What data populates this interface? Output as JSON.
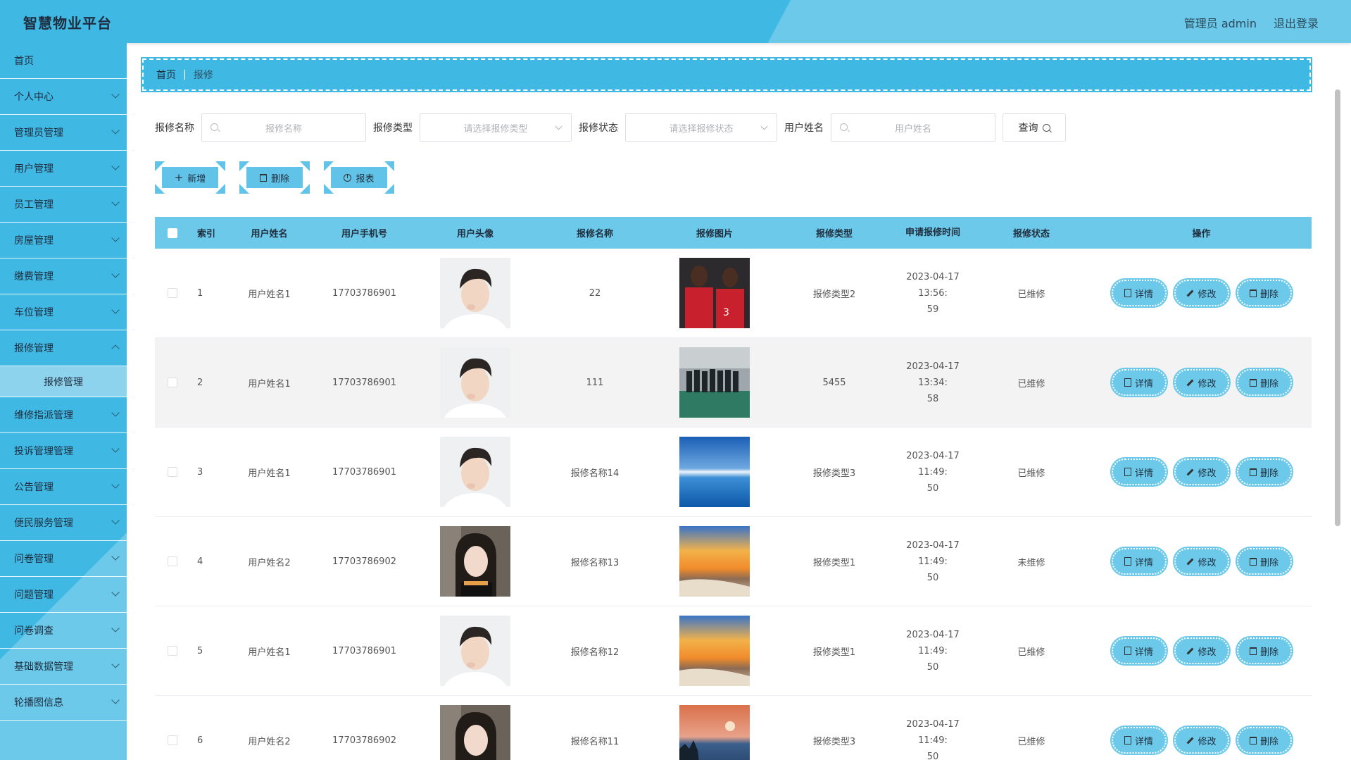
{
  "header": {
    "brand": "智慧物业平台",
    "user_label": "管理员 admin",
    "logout_label": "退出登录"
  },
  "sidebar": {
    "items": [
      {
        "label": "首页",
        "has_children": false
      },
      {
        "label": "个人中心",
        "has_children": true
      },
      {
        "label": "管理员管理",
        "has_children": true
      },
      {
        "label": "用户管理",
        "has_children": true
      },
      {
        "label": "员工管理",
        "has_children": true
      },
      {
        "label": "房屋管理",
        "has_children": true
      },
      {
        "label": "缴费管理",
        "has_children": true
      },
      {
        "label": "车位管理",
        "has_children": true
      },
      {
        "label": "报修管理",
        "has_children": true
      }
    ],
    "sub_item": "报修管理",
    "items_after": [
      {
        "label": "维修指派管理"
      },
      {
        "label": "投诉管理管理"
      },
      {
        "label": "公告管理"
      },
      {
        "label": "便民服务管理"
      },
      {
        "label": "问卷管理"
      },
      {
        "label": "问题管理"
      },
      {
        "label": "问卷调查"
      },
      {
        "label": "基础数据管理"
      },
      {
        "label": "轮播图信息"
      }
    ]
  },
  "breadcrumb": {
    "home": "首页",
    "current": "报修"
  },
  "search": {
    "name_label": "报修名称",
    "name_placeholder": "报修名称",
    "type_label": "报修类型",
    "type_placeholder": "请选择报修类型",
    "status_label": "报修状态",
    "status_placeholder": "请选择报修状态",
    "user_label": "用户姓名",
    "user_placeholder": "用户姓名",
    "query_label": "查询"
  },
  "actions": {
    "add": "新增",
    "delete": "删除",
    "report": "报表"
  },
  "table": {
    "columns": [
      "索引",
      "用户姓名",
      "用户手机号",
      "用户头像",
      "报修名称",
      "报修图片",
      "报修类型",
      "申请报修时间",
      "报修状态",
      "操作"
    ],
    "op_labels": {
      "detail": "详情",
      "edit": "修改",
      "delete": "删除"
    },
    "rows": [
      {
        "index": "1",
        "name": "用户姓名1",
        "phone": "17703786901",
        "avatar": "avatar-male",
        "repair_name": "22",
        "image": "basketball-players",
        "type": "报修类型2",
        "time_a": "2023-04-17 13:56:",
        "time_b": "59",
        "status": "已维修"
      },
      {
        "index": "2",
        "name": "用户姓名1",
        "phone": "17703786901",
        "avatar": "avatar-male",
        "repair_name": "111",
        "image": "team-photo",
        "type": "5455",
        "time_a": "2023-04-17 13:34:",
        "time_b": "58",
        "status": "已维修"
      },
      {
        "index": "3",
        "name": "用户姓名1",
        "phone": "17703786901",
        "avatar": "avatar-male",
        "repair_name": "报修名称14",
        "image": "ocean-sky",
        "type": "报修类型3",
        "time_a": "2023-04-17 11:49:",
        "time_b": "50",
        "status": "已维修"
      },
      {
        "index": "4",
        "name": "用户姓名2",
        "phone": "17703786902",
        "avatar": "avatar-female",
        "repair_name": "报修名称13",
        "image": "sunset-beach",
        "type": "报修类型1",
        "time_a": "2023-04-17 11:49:",
        "time_b": "50",
        "status": "未维修"
      },
      {
        "index": "5",
        "name": "用户姓名1",
        "phone": "17703786901",
        "avatar": "avatar-male",
        "repair_name": "报修名称12",
        "image": "sunset-beach",
        "type": "报修类型1",
        "time_a": "2023-04-17 11:49:",
        "time_b": "50",
        "status": "已维修"
      },
      {
        "index": "6",
        "name": "用户姓名2",
        "phone": "17703786902",
        "avatar": "avatar-female",
        "repair_name": "报修名称11",
        "image": "dusk-lake",
        "type": "报修类型3",
        "time_a": "2023-04-17 11:49:",
        "time_b": "50",
        "status": "已维修"
      }
    ]
  },
  "colors": {
    "primary": "#3fb8e4",
    "light": "#6cc9ea",
    "button": "#62c3e8"
  }
}
